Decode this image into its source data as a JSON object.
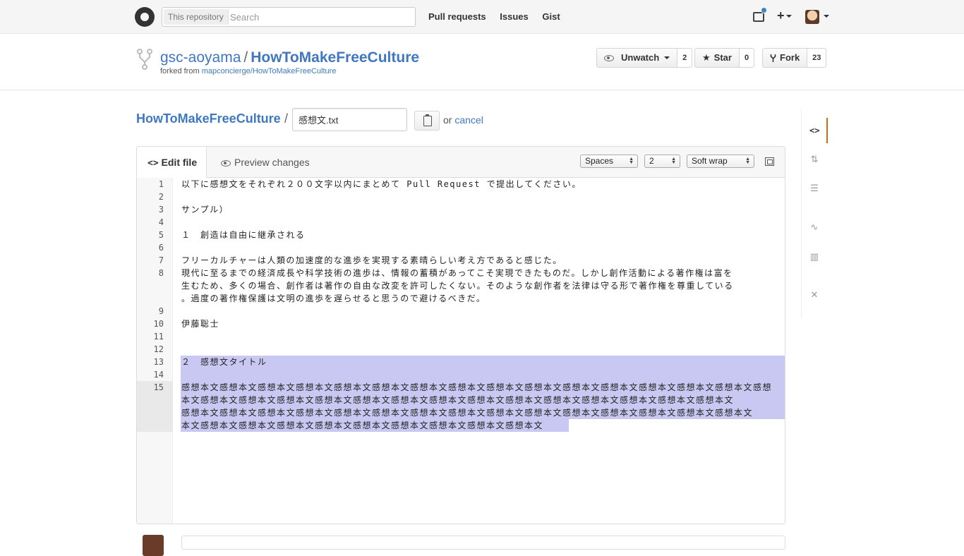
{
  "header": {
    "search_scope": "This repository",
    "search_placeholder": "Search",
    "nav": [
      "Pull requests",
      "Issues",
      "Gist"
    ],
    "plus_label": "+"
  },
  "repo": {
    "owner": "gsc-aoyama",
    "separator": "/",
    "name": "HowToMakeFreeCulture",
    "forked_from_prefix": "forked from",
    "forked_from": "mapconcierge/HowToMakeFreeCulture",
    "unwatch_label": "Unwatch",
    "watch_count": "2",
    "star_label": "Star",
    "star_count": "0",
    "fork_label": "Fork",
    "fork_count": "23"
  },
  "editbar": {
    "root": "HowToMakeFreeCulture",
    "separator": "/",
    "filename": "感想文.txt",
    "or": "or",
    "cancel": "cancel"
  },
  "editor": {
    "tab_edit": "Edit file",
    "tab_preview": "Preview changes",
    "indent_mode": "Spaces",
    "indent_size": "2",
    "wrap_mode": "Soft wrap",
    "lines": [
      {
        "n": "1",
        "rows": [
          "以下に感想文をそれぞれ２００文字以内にまとめて Pull Request で提出してください。"
        ]
      },
      {
        "n": "2",
        "rows": [
          ""
        ]
      },
      {
        "n": "3",
        "rows": [
          "サンプル）"
        ]
      },
      {
        "n": "4",
        "rows": [
          ""
        ]
      },
      {
        "n": "5",
        "rows": [
          "１　創造は自由に継承される"
        ]
      },
      {
        "n": "6",
        "rows": [
          ""
        ]
      },
      {
        "n": "7",
        "rows": [
          "フリーカルチャーは人類の加速度的な進歩を実現する素晴らしい考え方であると感じた。"
        ]
      },
      {
        "n": "8",
        "rows": [
          "現代に至るまでの経済成長や科学技術の進歩は、情報の蓄積があってこそ実現できたものだ。しかし創作活動による著作権は富を",
          "生むため、多くの場合、創作者は著作の自由な改変を許可したくない。そのような創作者を法律は守る形で著作権を尊重している",
          "。過度の著作権保護は文明の進歩を遅らせると思うので避けるべきだ。"
        ]
      },
      {
        "n": "9",
        "rows": [
          ""
        ]
      },
      {
        "n": "10",
        "rows": [
          "伊藤聡士"
        ]
      },
      {
        "n": "11",
        "rows": [
          ""
        ]
      },
      {
        "n": "12",
        "rows": [
          ""
        ]
      },
      {
        "n": "13",
        "rows": [
          "２　感想文タイトル"
        ]
      },
      {
        "n": "14",
        "rows": [
          ""
        ]
      },
      {
        "n": "15",
        "rows": [
          "感想本文感想本文感想本文感想本文感想本文感想本文感想本文感想本文感想本文感想本文感想本文感想本文感想本文感想本文感想本文感想",
          "本文感想本文感想本文感想本文感想本文感想本文感想本文感想本文感想本文感想本文感想本文感想本文感想本文感想本文感想本文",
          "感想本文感想本文感想本文感想本文感想本文感想本文感想本文感想本文感想本文感想本文感想本文感想本文感想本文感想本文感想本文",
          "本文感想本文感想本文感想本文感想本文感想本文感想本文感想本文感想本文感想本文"
        ]
      }
    ]
  }
}
